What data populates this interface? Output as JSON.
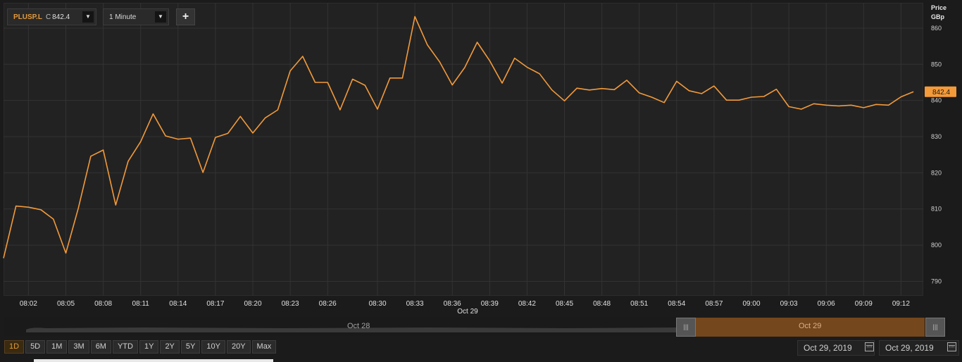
{
  "toolbar": {
    "symbol": "PLUSP.L",
    "close_label": "C",
    "close_value": "842.4",
    "interval": "1 Minute",
    "add_button": "+",
    "dropdown_glyph": "▼"
  },
  "axis_unit": {
    "line1": "Price",
    "line2": "GBp"
  },
  "last_price_badge": "842.4",
  "colors": {
    "line": "#f39a3a",
    "background": "#1b1b1b",
    "plot": "#222222",
    "grid": "#333333",
    "accent": "#e39a3c"
  },
  "chart_data": {
    "type": "line",
    "title": "",
    "xlabel": "Oct 29",
    "ylabel": "Price GBp",
    "grid": true,
    "ylim": [
      786,
      867
    ],
    "y_ticks": [
      790,
      800,
      810,
      820,
      830,
      840,
      850,
      860
    ],
    "x_ticks": [
      "08:02",
      "08:05",
      "08:08",
      "08:11",
      "08:14",
      "08:17",
      "08:20",
      "08:23",
      "08:26",
      "08:30",
      "08:33",
      "08:36",
      "08:39",
      "08:42",
      "08:45",
      "08:48",
      "08:51",
      "08:54",
      "08:57",
      "09:00",
      "09:03",
      "09:06",
      "09:09",
      "09:12"
    ],
    "x_start": "08:00",
    "x_interval_minutes": 1,
    "series": [
      {
        "values": [
          796.4,
          810.8,
          810.5,
          809.8,
          807.2,
          797.8,
          810.2,
          824.6,
          826.3,
          811.1,
          823.2,
          828.6,
          836.3,
          830.2,
          829.3,
          829.6,
          820.1,
          829.8,
          830.9,
          835.6,
          831.0,
          835.2,
          837.4,
          848.2,
          852.2,
          845.0,
          845.0,
          837.4,
          845.9,
          844.2,
          837.6,
          846.2,
          846.2,
          863.2,
          855.4,
          850.6,
          844.3,
          849.1,
          856.1,
          851.0,
          844.8,
          851.7,
          849.2,
          847.4,
          842.9,
          839.9,
          843.4,
          842.9,
          843.3,
          843.0,
          845.6,
          842.1,
          840.9,
          839.4,
          845.3,
          842.7,
          841.9,
          844.0,
          840.1,
          840.1,
          840.9,
          841.1,
          843.1,
          838.3,
          837.6,
          839.1,
          838.7,
          838.5,
          838.7,
          838.0,
          838.9,
          838.7,
          841.0,
          842.4
        ]
      }
    ]
  },
  "navigator": {
    "left_label": "Oct 28",
    "right_label": "Oct 29",
    "handle_glyph": "|||"
  },
  "range_buttons": [
    "1D",
    "5D",
    "1M",
    "3M",
    "6M",
    "YTD",
    "1Y",
    "2Y",
    "5Y",
    "10Y",
    "20Y",
    "Max"
  ],
  "range_active": "1D",
  "date_range": {
    "start": "Oct 29, 2019",
    "end": "Oct 29, 2019"
  }
}
